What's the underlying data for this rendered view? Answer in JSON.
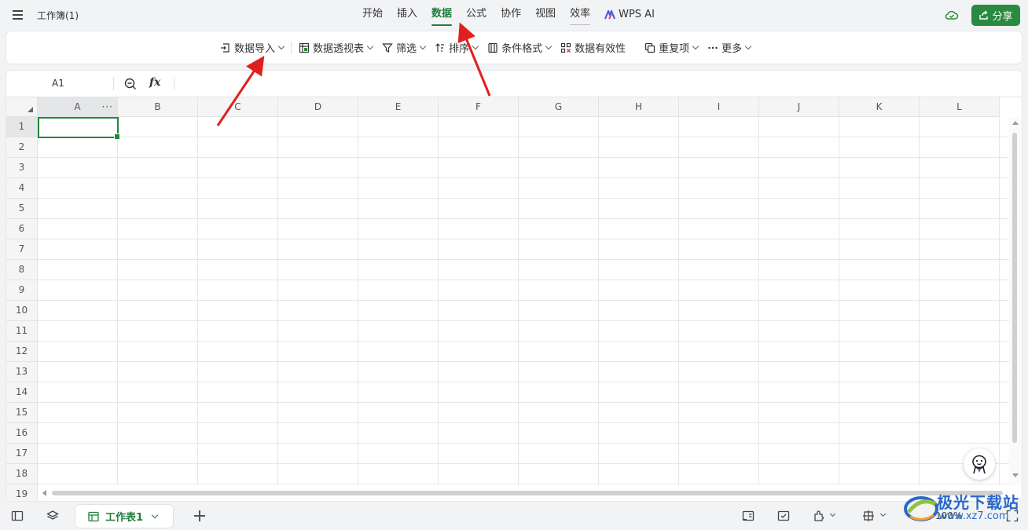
{
  "window": {
    "doc_title": "工作簿(1)",
    "share_label": "分享"
  },
  "tabs": [
    {
      "label": "开始",
      "active": false
    },
    {
      "label": "插入",
      "active": false
    },
    {
      "label": "数据",
      "active": true
    },
    {
      "label": "公式",
      "active": false
    },
    {
      "label": "协作",
      "active": false
    },
    {
      "label": "视图",
      "active": false
    },
    {
      "label": "效率",
      "active": false
    },
    {
      "label": "WPS AI",
      "active": false
    }
  ],
  "toolbar": {
    "import_label": "数据导入",
    "pivot_label": "数据透视表",
    "filter_label": "筛选",
    "sort_label": "排序",
    "cond_format_label": "条件格式",
    "validation_label": "数据有效性",
    "duplicates_label": "重复项",
    "more_label": "更多"
  },
  "formula_bar": {
    "name_box": "A1",
    "fx_label": "fx"
  },
  "columns": [
    "A",
    "B",
    "C",
    "D",
    "E",
    "F",
    "G",
    "H",
    "I",
    "J",
    "K",
    "L"
  ],
  "rows": [
    "1",
    "2",
    "3",
    "4",
    "5",
    "6",
    "7",
    "8",
    "9",
    "10",
    "11",
    "12",
    "13",
    "14",
    "15",
    "16",
    "17",
    "18",
    "19"
  ],
  "column_more": "···",
  "sheet_tabs": [
    {
      "label": "工作表1",
      "active": true
    }
  ],
  "status": {
    "zoom": "100%"
  },
  "watermark": {
    "text": "极光下载站",
    "url": "www.xz7.com"
  },
  "colors": {
    "accent": "#1e7f3d",
    "share_bg": "#2a8a3f",
    "annotation_arrow": "#e02020"
  },
  "icons": {
    "menu": "hamburger-menu-icon",
    "cloud": "cloud-sync-icon",
    "share": "share-icon",
    "import": "import-icon",
    "pivot": "pivot-table-icon",
    "filter": "filter-icon",
    "sort": "sort-icon",
    "cond_format": "conditional-format-icon",
    "validation": "data-validation-icon",
    "duplicates": "duplicates-icon",
    "more": "more-dots-icon",
    "zoom": "zoom-out-icon",
    "sheet": "sheet-grid-icon",
    "assistant": "assistant-avatar-icon"
  }
}
